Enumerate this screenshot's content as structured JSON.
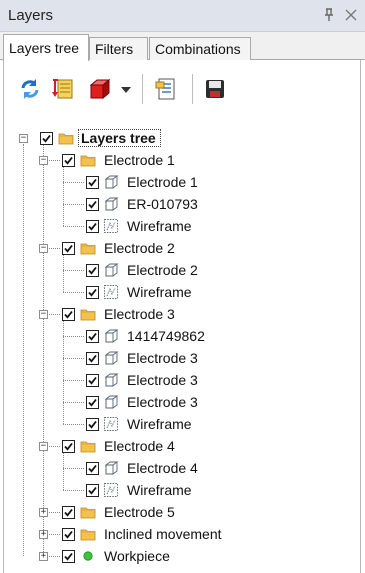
{
  "panel": {
    "title": "Layers"
  },
  "tabs": [
    {
      "label": "Layers tree",
      "active": true
    },
    {
      "label": "Filters",
      "active": false
    },
    {
      "label": "Combinations",
      "active": false
    }
  ],
  "toolbar": {
    "buttons": [
      {
        "icon": "refresh-icon"
      },
      {
        "icon": "layer-sort-icon"
      },
      {
        "icon": "red-cube-icon",
        "dropdown": true
      },
      {
        "icon": "layer-properties-icon"
      },
      {
        "icon": "save-icon"
      }
    ]
  },
  "tree": {
    "nodes": [
      {
        "label": "Layers tree",
        "level": 0,
        "icon": "folder-icon",
        "expander": "minus",
        "checked": true,
        "root": true
      },
      {
        "label": "Electrode 1",
        "level": 1,
        "icon": "folder-icon",
        "expander": "minus",
        "checked": true
      },
      {
        "label": "Electrode 1",
        "level": 2,
        "icon": "wire-cube-icon",
        "checked": true
      },
      {
        "label": "ER-010793",
        "level": 2,
        "icon": "wire-cube-icon",
        "checked": true
      },
      {
        "label": "Wireframe",
        "level": 2,
        "icon": "wireframe-icon",
        "checked": true
      },
      {
        "label": "Electrode 2",
        "level": 1,
        "icon": "folder-icon",
        "expander": "minus",
        "checked": true
      },
      {
        "label": "Electrode 2",
        "level": 2,
        "icon": "wire-cube-icon",
        "checked": true
      },
      {
        "label": "Wireframe",
        "level": 2,
        "icon": "wireframe-icon",
        "checked": true
      },
      {
        "label": "Electrode 3",
        "level": 1,
        "icon": "folder-icon",
        "expander": "minus",
        "checked": true
      },
      {
        "label": "1414749862",
        "level": 2,
        "icon": "wire-cube-icon",
        "checked": true
      },
      {
        "label": "Electrode 3",
        "level": 2,
        "icon": "wire-cube-icon",
        "checked": true
      },
      {
        "label": "Electrode 3",
        "level": 2,
        "icon": "wire-cube-icon",
        "checked": true
      },
      {
        "label": "Electrode 3",
        "level": 2,
        "icon": "wire-cube-icon",
        "checked": true
      },
      {
        "label": "Wireframe",
        "level": 2,
        "icon": "wireframe-icon",
        "checked": true
      },
      {
        "label": "Electrode 4",
        "level": 1,
        "icon": "folder-icon",
        "expander": "minus",
        "checked": true
      },
      {
        "label": "Electrode 4",
        "level": 2,
        "icon": "wire-cube-icon",
        "checked": true
      },
      {
        "label": "Wireframe",
        "level": 2,
        "icon": "wireframe-icon",
        "checked": true
      },
      {
        "label": "Electrode 5",
        "level": 1,
        "icon": "folder-icon",
        "expander": "plus",
        "checked": true
      },
      {
        "label": "Inclined movement",
        "level": 1,
        "icon": "folder-icon",
        "expander": "plus",
        "checked": true
      },
      {
        "label": "Workpiece",
        "level": 1,
        "icon": "green-dot-icon",
        "expander": "plus",
        "checked": true
      }
    ]
  },
  "colors": {
    "titlebar": "#dfe4ec",
    "folder": "#f2c14e",
    "workpiece_dot": "#3cc43c",
    "red_cube": "#e02020"
  }
}
